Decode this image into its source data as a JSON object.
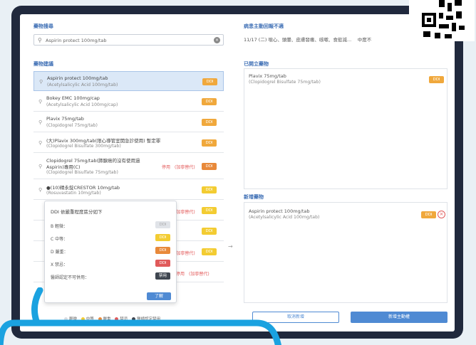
{
  "sections": {
    "drug_search": "藥物搜尋",
    "drug_suggestions": "藥物建議",
    "hospital_active_reminder": "病患主動回報不適",
    "prescribed_drugs": "已開立藥物",
    "new_drugs": "新增藥物"
  },
  "search": {
    "value": "Aspirin protect 100mg/tab"
  },
  "reminder_text": "11/17 (二) 噁心、頭暈、皮膚發癢、咳嗽、食慾減... 　中度不",
  "suggestions": [
    {
      "name": "Aspirin protect 100mg/tab",
      "generic": "(Acetylsalicylic Acid 100mg/tab)",
      "badge": "DDI",
      "badge_color": "orange",
      "selected": true
    },
    {
      "name": "Bokey EMC 100mg/cap",
      "generic": "(Acetylsalicylic Acid 100mg/cap)",
      "badge": "DDI",
      "badge_color": "orange",
      "selected": false
    },
    {
      "name": "Plavix 75mg/tab",
      "generic": "(Clopidogrel 75mg/tab)",
      "badge": "DDI",
      "badge_color": "orange",
      "selected": false
    },
    {
      "name": "(大)Plavix 300mg/tab(限心導管室開急診使用) 暫定罪",
      "generic": "(Clopidogrel Bisulfate 300mg/tab)",
      "badge": "DDI",
      "badge_color": "orange",
      "selected": false
    },
    {
      "name": "Clopidogrel 75mg/tab(肺腺癌的沒有使用過",
      "name2": "Aspirin)專用(C)",
      "generic": "(Clopidogrel Bisulfate 75mg/tab)",
      "warning": "停用　(加寧替代)",
      "badge": "DDI",
      "badge_color": "dark-orange",
      "selected": false
    },
    {
      "name": "●(10)精永錠CRESTOR 10mg/tab",
      "generic": "(Rosuvastatin 10mg/tab)",
      "badge": "DDI",
      "badge_color": "yellow",
      "selected": false
    },
    {
      "warning": "(加寧替代)",
      "badge": "DDI",
      "badge_color": "yellow"
    },
    {
      "badge": "DDI",
      "badge_color": "yellow"
    },
    {
      "warning": "(加寧替代)",
      "badge": "DDI",
      "badge_color": "yellow"
    },
    {
      "warning": "停用　(加寧替代)"
    }
  ],
  "ddi_popup": {
    "title": "DDI 依嚴重程度區分如下",
    "levels": [
      {
        "label": "B 輕微：",
        "badge": "DDI",
        "color": "gray"
      },
      {
        "label": "C 中等：",
        "badge": "DDI",
        "color": "yellow"
      },
      {
        "label": "D 嚴重：",
        "badge": "DDI",
        "color": "dark-orange"
      },
      {
        "label": "X 禁忌：",
        "badge": "DDI",
        "color": "red"
      },
      {
        "label": "醫師認定不可併用：",
        "badge": "禁用",
        "color": "dark"
      }
    ],
    "ok_label": "了解"
  },
  "legend": [
    {
      "label": "輕微",
      "color": "#d8dce2"
    },
    {
      "label": "中等",
      "color": "#f3cc32"
    },
    {
      "label": "嚴重",
      "color": "#e8893a"
    },
    {
      "label": "禁忌",
      "color": "#e05a5a"
    },
    {
      "label": "醫師認定禁用",
      "color": "#3f4650"
    }
  ],
  "prescribed": {
    "name": "Plavix 75mg/tab",
    "generic": "(Clopidogrel Bisulfate 75mg/tab)",
    "badge": "DDI"
  },
  "new_drug": {
    "name": "Aspirin protect 100mg/tab",
    "generic": "(Acetylsalicylic Acid 100mg/tab)",
    "badge": "DDI"
  },
  "buttons": {
    "cancel": "取消新增",
    "confirm": "新增主動權"
  },
  "colors": {
    "accent": "#4f8ad3",
    "frame": "#20293d",
    "bubble": "#1aa2e0"
  }
}
